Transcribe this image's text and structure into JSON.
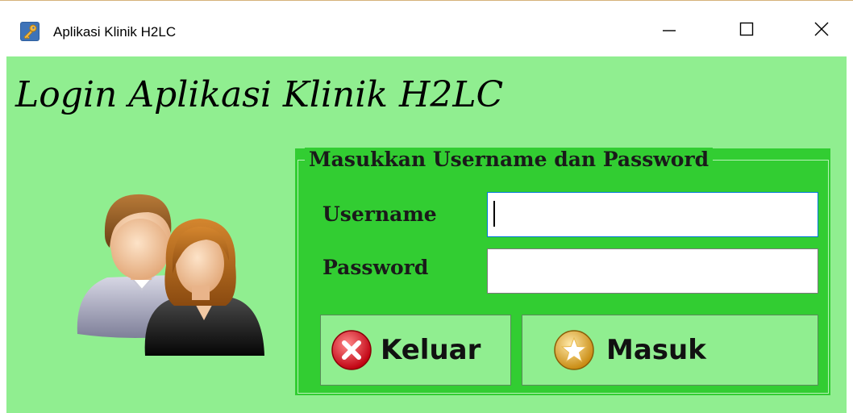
{
  "window": {
    "title": "Aplikasi Klinik H2LC",
    "controls": [
      "minimize",
      "maximize",
      "close"
    ]
  },
  "heading": "Login Aplikasi Klinik H2LC",
  "login_panel": {
    "legend": "Masukkan Username dan Password",
    "username_label": "Username",
    "username_value": "",
    "password_label": "Password",
    "password_value": ""
  },
  "buttons": {
    "exit_label": "Keluar",
    "login_label": "Masuk"
  },
  "icons": {
    "app": "key-icon",
    "users": "users-icon",
    "exit": "close-circle-icon",
    "login": "star-circle-icon"
  },
  "colors": {
    "background": "#90ee90",
    "panel": "#32cd32",
    "input_focus": "#0078d7"
  }
}
